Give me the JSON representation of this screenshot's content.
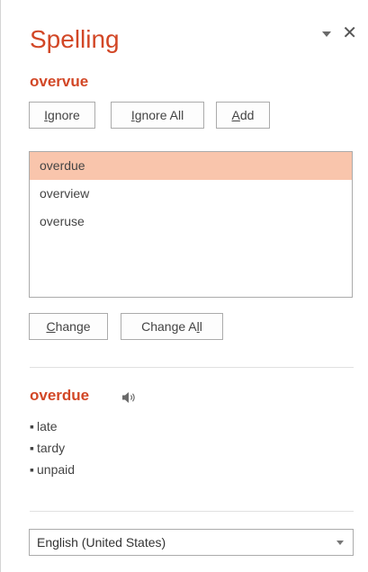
{
  "pane": {
    "title": "Spelling",
    "menu_icon": "chevron-down-icon",
    "close_glyph": "✕"
  },
  "misspelling": {
    "word": "overvue"
  },
  "actions": {
    "ignore": {
      "pre": "",
      "key": "I",
      "post": "gnore"
    },
    "ignore_all": {
      "pre": "",
      "key": "I",
      "post": "gnore All"
    },
    "add": {
      "pre": "",
      "key": "A",
      "post": "dd"
    },
    "change": {
      "pre": "",
      "key": "C",
      "post": "hange"
    },
    "change_all": {
      "pre": "Change A",
      "key": "l",
      "post": "l"
    }
  },
  "suggestions": [
    {
      "text": "overdue",
      "selected": true
    },
    {
      "text": "overview",
      "selected": false
    },
    {
      "text": "overuse",
      "selected": false
    }
  ],
  "definition": {
    "word": "overdue",
    "speaker_icon": "speaker-icon",
    "synonyms": [
      "late",
      "tardy",
      "unpaid"
    ]
  },
  "language": {
    "selected": "English (United States)"
  },
  "colors": {
    "accent": "#d24726",
    "selection": "#f9c5ac",
    "border": "#ababab"
  }
}
